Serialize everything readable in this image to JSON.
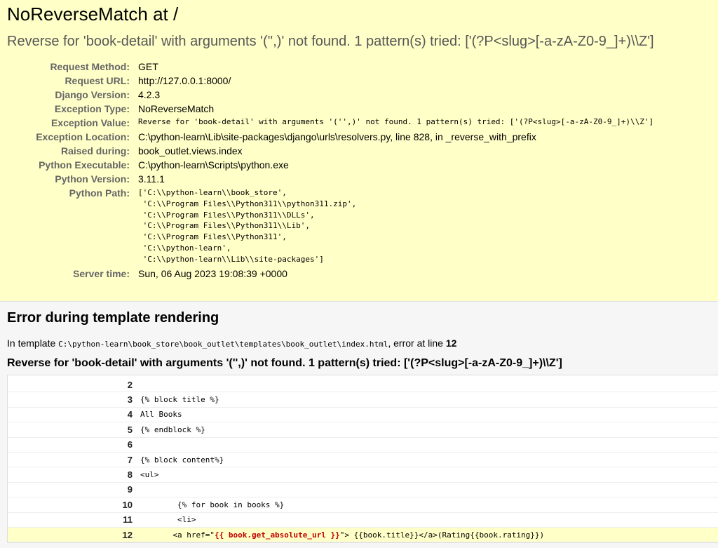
{
  "summary": {
    "title": "NoReverseMatch at /",
    "message": "Reverse for 'book-detail' with arguments '('',)' not found. 1 pattern(s) tried: ['(?P<slug>[-a-zA-Z0-9_]+)\\\\Z']",
    "meta": [
      {
        "label": "Request Method:",
        "value": "GET",
        "mono": false
      },
      {
        "label": "Request URL:",
        "value": "http://127.0.0.1:8000/",
        "mono": false
      },
      {
        "label": "Django Version:",
        "value": "4.2.3",
        "mono": false
      },
      {
        "label": "Exception Type:",
        "value": "NoReverseMatch",
        "mono": false
      },
      {
        "label": "Exception Value:",
        "value": "Reverse for 'book-detail' with arguments '('',)' not found. 1 pattern(s) tried: ['(?P<slug>[-a-zA-Z0-9_]+)\\\\Z']",
        "mono": true
      },
      {
        "label": "Exception Location:",
        "value": "C:\\python-learn\\Lib\\site-packages\\django\\urls\\resolvers.py, line 828, in _reverse_with_prefix",
        "mono": false
      },
      {
        "label": "Raised during:",
        "value": "book_outlet.views.index",
        "mono": false
      },
      {
        "label": "Python Executable:",
        "value": "C:\\python-learn\\Scripts\\python.exe",
        "mono": false
      },
      {
        "label": "Python Version:",
        "value": "3.11.1",
        "mono": false
      }
    ],
    "python_path_label": "Python Path:",
    "python_path": [
      "['C:\\\\python-learn\\\\book_store',",
      " 'C:\\\\Program Files\\\\Python311\\\\python311.zip',",
      " 'C:\\\\Program Files\\\\Python311\\\\DLLs',",
      " 'C:\\\\Program Files\\\\Python311\\\\Lib',",
      " 'C:\\\\Program Files\\\\Python311',",
      " 'C:\\\\python-learn',",
      " 'C:\\\\python-learn\\\\Lib\\\\site-packages']"
    ],
    "server_time_label": "Server time:",
    "server_time": "Sun, 06 Aug 2023 19:08:39 +0000"
  },
  "template": {
    "heading": "Error during template rendering",
    "in_template": "In template ",
    "template_path": "C:\\python-learn\\book_store\\book_outlet\\templates\\book_outlet\\index.html",
    "error_at": ", error at line ",
    "error_line": "12",
    "message": "Reverse for 'book-detail' with arguments '('',)' not found. 1 pattern(s) tried: ['(?P<slug>[-a-zA-Z0-9_]+)\\\\Z']",
    "lines": [
      {
        "num": "2",
        "code": "",
        "error": false
      },
      {
        "num": "3",
        "code": "{% block title %}",
        "error": false
      },
      {
        "num": "4",
        "code": "All Books",
        "error": false
      },
      {
        "num": "5",
        "code": "{% endblock %}",
        "error": false
      },
      {
        "num": "6",
        "code": "",
        "error": false
      },
      {
        "num": "7",
        "code": "{% block content%}",
        "error": false
      },
      {
        "num": "8",
        "code": "<ul>",
        "error": false
      },
      {
        "num": "9",
        "code": "",
        "error": false
      },
      {
        "num": "10",
        "code": "        {% for book in books %}",
        "error": false
      },
      {
        "num": "11",
        "code": "        <li>",
        "error": false
      },
      {
        "num": "12",
        "pre": "       <a href=\"",
        "hl": "{{ book.get_absolute_url }}",
        "post": "\"> {{book.title}}</a>(Rating{{book.rating}})",
        "error": true
      }
    ]
  }
}
